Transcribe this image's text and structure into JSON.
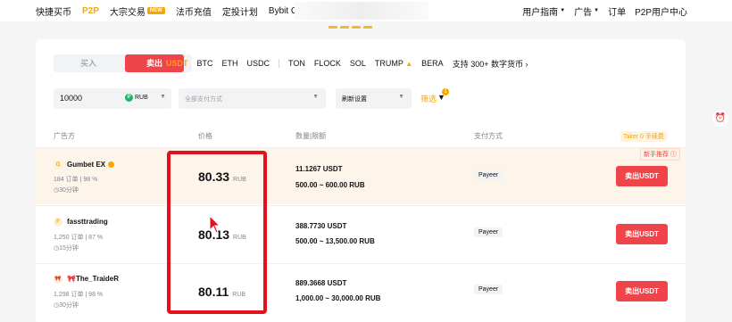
{
  "nav": {
    "items": [
      "快捷买币",
      "P2P",
      "大宗交易",
      "法币充值",
      "定投计划",
      "Bybit Card"
    ],
    "active_index": 1,
    "new_badge": "NEW",
    "right": [
      "用户指南",
      "广告",
      "订单",
      "P2P用户中心"
    ]
  },
  "trade": {
    "buy_label": "买入",
    "sell_label": "卖出",
    "coins": [
      "USDT",
      "BTC",
      "ETH",
      "USDC",
      "TON",
      "FLOCK",
      "SOL",
      "TRUMP",
      "BERA"
    ],
    "more_coins": "支持 300+ 数字货币"
  },
  "filters": {
    "amount_value": "10000",
    "currency": "RUB",
    "payment_placeholder": "全部支付方式",
    "refresh": "刷新设置",
    "filter_label": "筛选",
    "filter_count": "1"
  },
  "table": {
    "headers": [
      "广告方",
      "价格",
      "数量|限额",
      "支付方式"
    ],
    "taker_fee": "Taker 0 手续费",
    "recommend_badge": "新手推荐",
    "rows": [
      {
        "avatar": "G",
        "name": "Gumbet EX",
        "stats": "184 订单  |  98 %",
        "time": "30分钟",
        "price": "80.33",
        "unit": "RUB",
        "qty": "11.1267 USDT",
        "limit": "500.00 ~ 600.00 RUB",
        "payment": "Payeer",
        "action": "卖出USDT"
      },
      {
        "avatar": "F",
        "name": "fassttrading",
        "stats": "1,250 订单  |  87 %",
        "time": "15分钟",
        "price": "80.13",
        "unit": "RUB",
        "qty": "388.7730 USDT",
        "limit": "500.00 ~ 13,500.00 RUB",
        "payment": "Payeer",
        "action": "卖出USDT"
      },
      {
        "avatar": "🎀",
        "name": "🎀The_TraideR",
        "stats": "1,298 订单  |  98 %",
        "time": "30分钟",
        "price": "80.11",
        "unit": "RUB",
        "qty": "889.3668 USDT",
        "limit": "1,000.00 ~ 30,000.00 RUB",
        "payment": "Payeer",
        "action": "卖出USDT"
      }
    ]
  },
  "colors": {
    "accent": "#f7a600",
    "sell": "#ef454a",
    "annotation": "#e4101c"
  }
}
